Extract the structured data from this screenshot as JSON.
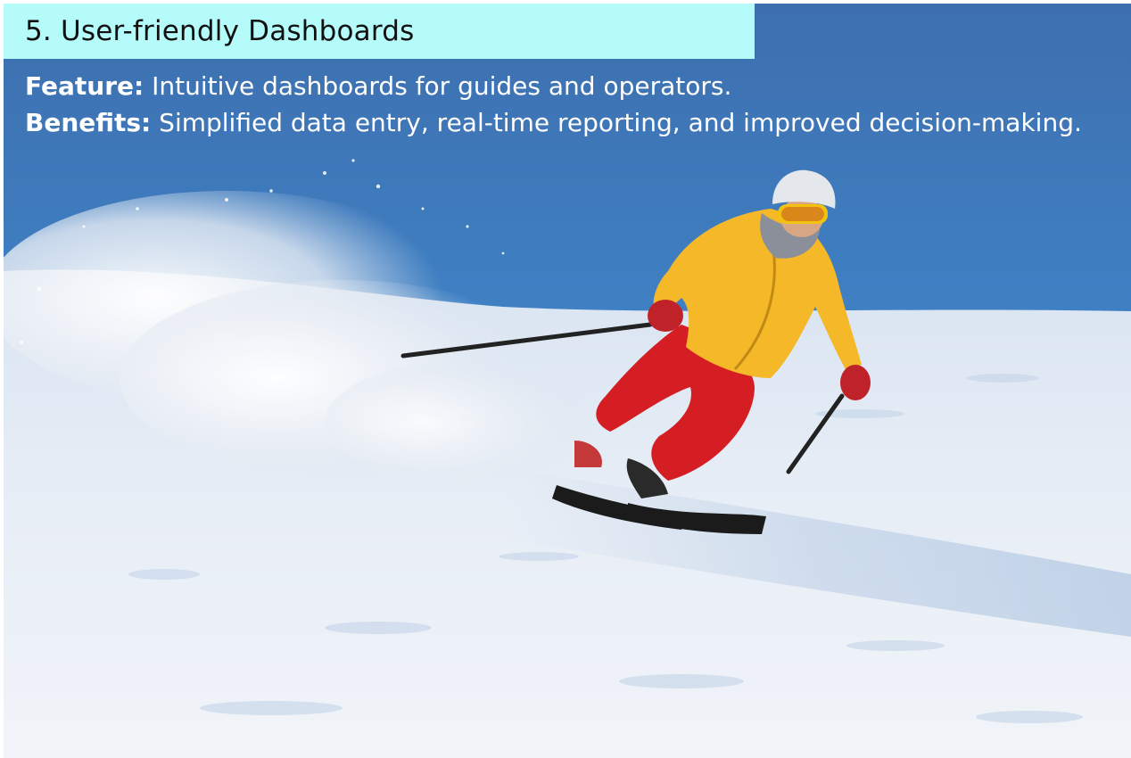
{
  "slide": {
    "title": "5. User-friendly Dashboards",
    "feature_label": "Feature:",
    "feature_text": " Intuitive dashboards for guides and operators.",
    "benefits_label": "Benefits:",
    "benefits_text": " Simplified data entry, real-time reporting, and improved decision-making.",
    "image": "photo of skier in yellow jacket carving through fresh snow under blue sky"
  },
  "colors": {
    "title_bar": "#b4fbf9",
    "sky": "#3f7fc0",
    "jacket": "#f4b829",
    "pants": "#d51e24",
    "snow": "#e7edf6"
  }
}
